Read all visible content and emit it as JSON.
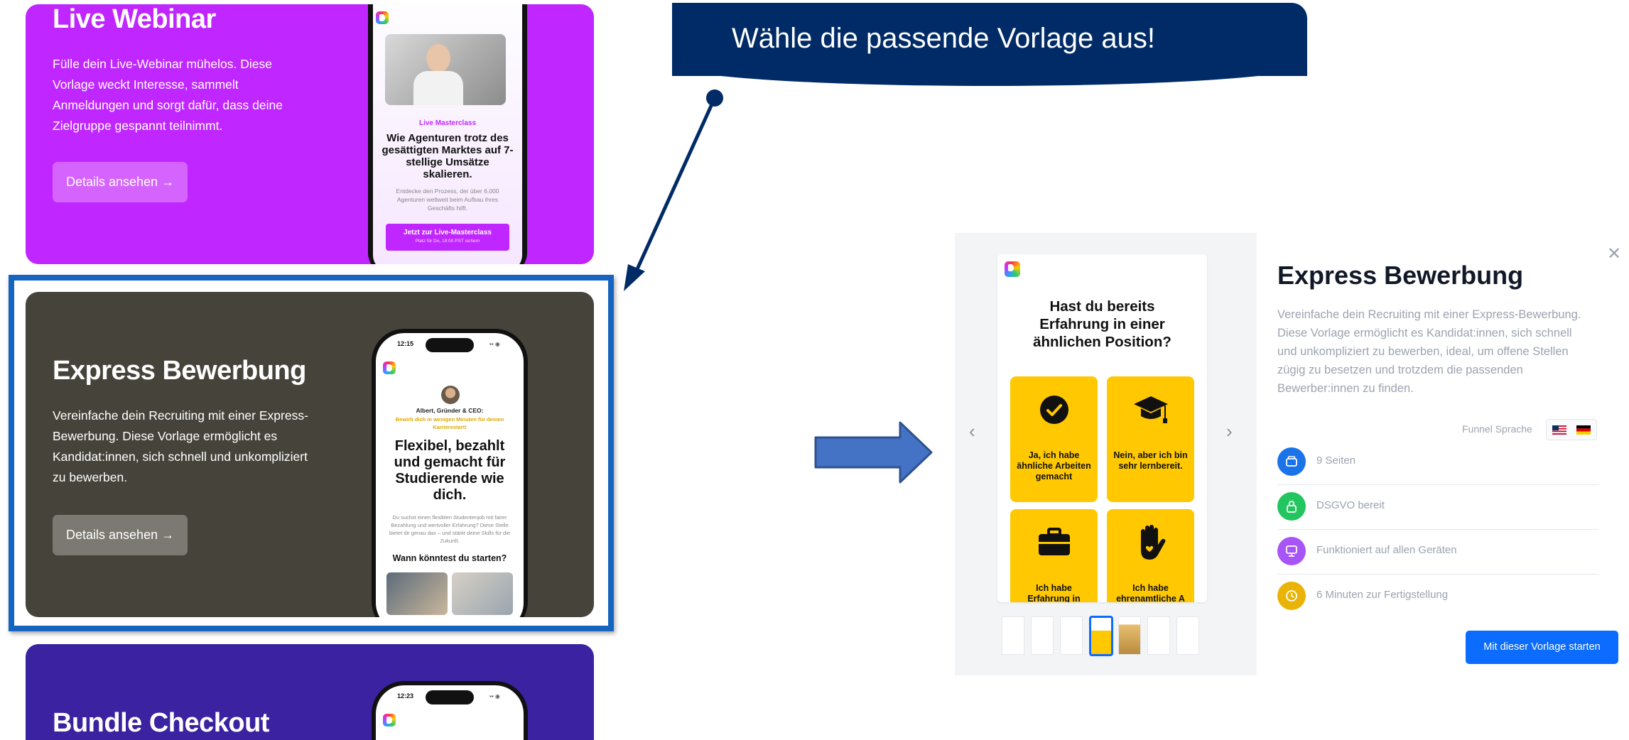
{
  "cards": {
    "webinar": {
      "title": "Live Webinar",
      "description": "Fülle dein Live-Webinar mühelos. Diese Vorlage weckt Interesse, sammelt Anmeldungen und sorgt dafür, dass deine Zielgruppe gespannt teilnimmt.",
      "button": "Details ansehen →",
      "bg_color": "#c026ff",
      "phone": {
        "tag": "Live Masterclass",
        "headline": "Wie Agenturen trotz des gesättigten Marktes auf 7-stellige Umsätze skalieren.",
        "sub": "Entdecke den Prozess, der über 6.000 Agenturen weltweit beim Aufbau ihres Geschäfts hilft.",
        "cta": "Jetzt zur Live-Masterclass",
        "cta_sub": "Platz für Do, 19:00 PST sichern"
      }
    },
    "express": {
      "title": "Express Bewerbung",
      "description": "Vereinfache dein Recruiting mit einer Express-Bewerbung. Diese Vorlage ermöglicht es Kandidat:innen, sich schnell und unkompliziert zu bewerben.",
      "button": "Details ansehen →",
      "bg_color": "#46443a",
      "phone": {
        "time": "12:15",
        "author": "Albert, Gründer & CEO:",
        "author_sub": "Bewirb dich in wenigen Minuten für deinen Karrierestart!",
        "headline": "Flexibel, bezahlt und gemacht für Studierende wie dich.",
        "sub": "Du suchst einen flexiblen Studentenjob mit fairer Bezahlung und wertvoller Erfahrung? Diese Stelle bietet dir genau das – und stärkt deine Skills für die Zukunft.",
        "question": "Wann könntest du starten?"
      }
    },
    "bundle": {
      "title": "Bundle Checkout",
      "bg_color": "#3a22a0",
      "phone": {
        "time": "12:23"
      }
    }
  },
  "banner": {
    "text": "Wähle die passende Vorlage aus!",
    "color": "#002b66"
  },
  "modal": {
    "title": "Express Bewerbung",
    "description": "Vereinfache dein Recruiting mit einer Express-Bewerbung. Diese Vorlage ermöglicht es Kandidat:innen, sich schnell und unkompliziert zu bewerben, ideal, um offene Stellen zügig zu besetzen und trotzdem die passenden Bewerber:innen zu finden.",
    "language_label": "Funnel Sprache",
    "languages": [
      "us-flag-icon",
      "de-flag-icon"
    ],
    "features": [
      {
        "label": "9 Seiten",
        "icon": "pages-icon",
        "color": "#1a73e8"
      },
      {
        "label": "DSGVO bereit",
        "icon": "lock-icon",
        "color": "#22c55e"
      },
      {
        "label": "Funktioniert auf allen Geräten",
        "icon": "monitor-icon",
        "color": "#a855f7"
      },
      {
        "label": "6 Minuten zur Fertigstellung",
        "icon": "clock-icon",
        "color": "#eab308"
      }
    ],
    "start_button": "Mit dieser Vorlage starten",
    "accent": "#0b6cff",
    "preview": {
      "question": "Hast du bereits Erfahrung in einer ähnlichen Position?",
      "options": [
        {
          "label": "Ja, ich habe ähnliche Arbeiten gemacht",
          "icon": "check-circle-icon"
        },
        {
          "label": "Nein, aber ich bin sehr lernbereit.",
          "icon": "graduation-cap-icon"
        },
        {
          "label": "Ich habe Erfahrung in",
          "icon": "briefcase-icon"
        },
        {
          "label": "Ich habe ehrenamtliche A",
          "icon": "hand-heart-icon"
        }
      ],
      "selected_thumbnail": 4,
      "thumbnail_count": 7
    }
  }
}
